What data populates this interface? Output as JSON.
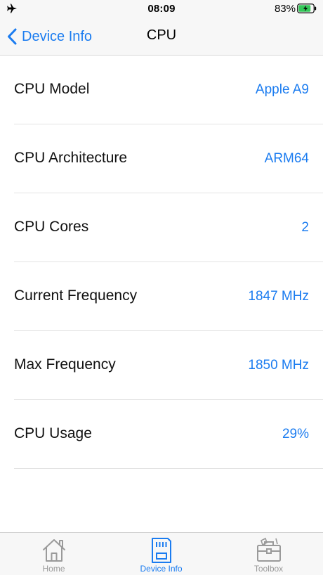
{
  "status_bar": {
    "time": "08:09",
    "battery_percent": "83%",
    "battery_level": 0.83,
    "airplane_icon": "airplane-icon",
    "battery_icon": "battery-charging-icon"
  },
  "nav": {
    "back_label": "Device Info",
    "title": "CPU"
  },
  "colors": {
    "accent": "#1b7cf0",
    "inactive": "#9a9a9a",
    "battery_fill": "#34c759"
  },
  "rows": [
    {
      "label": "CPU Model",
      "value": "Apple A9"
    },
    {
      "label": "CPU Architecture",
      "value": "ARM64"
    },
    {
      "label": "CPU Cores",
      "value": "2"
    },
    {
      "label": "Current Frequency",
      "value": "1847 MHz"
    },
    {
      "label": "Max Frequency",
      "value": "1850 MHz"
    },
    {
      "label": "CPU Usage",
      "value": "29%"
    }
  ],
  "tabs": [
    {
      "label": "Home",
      "icon": "home-icon",
      "active": false
    },
    {
      "label": "Device Info",
      "icon": "sd-card-icon",
      "active": true
    },
    {
      "label": "Toolbox",
      "icon": "toolbox-icon",
      "active": false
    }
  ]
}
